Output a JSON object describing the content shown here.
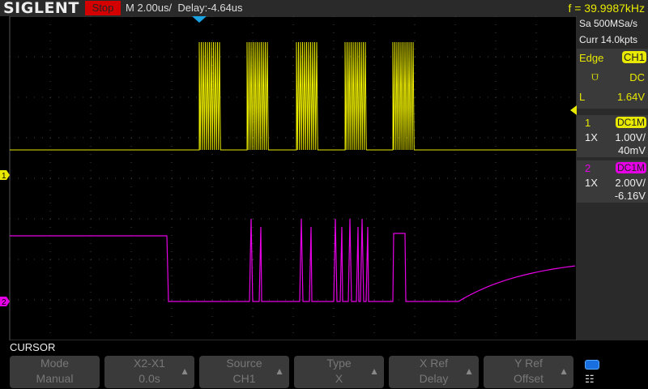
{
  "header": {
    "brand": "SIGLENT",
    "run_state": "Stop",
    "timebase": "M 2.00us/",
    "delay": "Delay:-4.64us",
    "frequency": "f = 39.9987kHz"
  },
  "acq": {
    "sample_rate": "Sa 500MSa/s",
    "memory": "Curr 14.0kpts"
  },
  "trigger": {
    "type": "Edge",
    "source": "CH1",
    "coupling": "DC",
    "level_label": "L",
    "level": "1.64V",
    "slope_icon": "rising-edge-icon"
  },
  "ch1": {
    "num": "1",
    "coupling": "DC1M",
    "probe": "1X",
    "scale": "1.00V/",
    "offset": "40mV",
    "color": "#e8e800"
  },
  "ch2": {
    "num": "2",
    "coupling": "DC1M",
    "probe": "1X",
    "scale": "2.00V/",
    "offset": "-6.16V",
    "color": "#e600e6"
  },
  "menu": {
    "title": "CURSOR",
    "buttons": [
      {
        "top": "Mode",
        "bottom": "Manual"
      },
      {
        "top": "X2-X1",
        "bottom": "0.0s"
      },
      {
        "top": "Source",
        "bottom": "CH1"
      },
      {
        "top": "Type",
        "bottom": "X"
      },
      {
        "top": "X Ref",
        "bottom": "Delay"
      },
      {
        "top": "Y Ref",
        "bottom": "Offset"
      }
    ]
  },
  "markers": {
    "ch1": "1",
    "ch2": "2"
  }
}
